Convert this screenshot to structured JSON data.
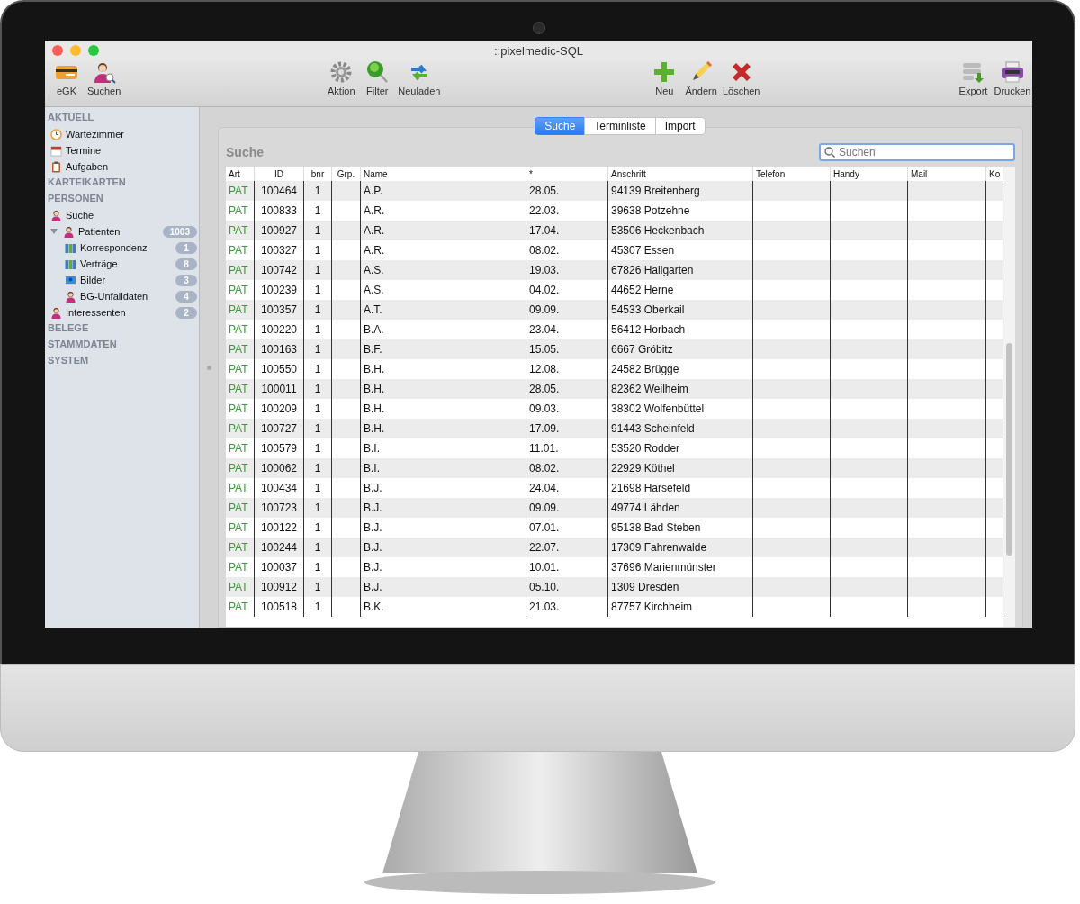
{
  "window": {
    "title": "::pixelmedic-SQL"
  },
  "toolbar": {
    "groups": [
      [
        {
          "label": "eGK",
          "kind": "card"
        },
        {
          "label": "Suchen",
          "kind": "person-search"
        }
      ],
      [
        {
          "label": "Aktion",
          "kind": "gear"
        },
        {
          "label": "Filter",
          "kind": "filter"
        },
        {
          "label": "Neuladen",
          "kind": "reload"
        }
      ],
      [
        {
          "label": "Neu",
          "kind": "plus"
        },
        {
          "label": "Ändern",
          "kind": "pencil"
        },
        {
          "label": "Löschen",
          "kind": "cross"
        }
      ],
      [
        {
          "label": "Export",
          "kind": "export"
        },
        {
          "label": "Drucken",
          "kind": "printer"
        }
      ]
    ]
  },
  "sidebar": {
    "sections": [
      {
        "title": "AKTUELL",
        "items": [
          {
            "label": "Wartezimmer",
            "kind": "clock"
          },
          {
            "label": "Termine",
            "kind": "calendar"
          },
          {
            "label": "Aufgaben",
            "kind": "clipboard"
          }
        ]
      },
      {
        "title": "KARTEIKARTEN"
      },
      {
        "title": "PERSONEN",
        "items": [
          {
            "label": "Suche",
            "kind": "person"
          },
          {
            "label": "Patienten",
            "kind": "person",
            "badge": "1003",
            "expanded": true,
            "children": [
              {
                "label": "Korrespondenz",
                "kind": "folders",
                "badge": "1"
              },
              {
                "label": "Verträge",
                "kind": "folders",
                "badge": "8"
              },
              {
                "label": "Bilder",
                "kind": "picture",
                "badge": "3"
              },
              {
                "label": "BG-Unfalldaten",
                "kind": "person",
                "badge": "4"
              }
            ]
          },
          {
            "label": "Interessenten",
            "kind": "person",
            "badge": "2"
          }
        ]
      },
      {
        "title": "BELEGE"
      },
      {
        "title": "STAMMDATEN"
      },
      {
        "title": "SYSTEM"
      }
    ]
  },
  "tabs": [
    {
      "label": "Suche",
      "selected": true
    },
    {
      "label": "Terminliste",
      "selected": false
    },
    {
      "label": "Import",
      "selected": false
    }
  ],
  "panel": {
    "title": "Suche"
  },
  "search": {
    "placeholder": "Suchen"
  },
  "table": {
    "columns": [
      "Art",
      "ID",
      "bnr",
      "Grp.",
      "Name",
      "*",
      "Anschrift",
      "Telefon",
      "Handy",
      "Mail",
      "Ko"
    ],
    "rows": [
      [
        "PAT",
        "100464",
        "1",
        "",
        "A.P.",
        "28.05.",
        "94139 Breitenberg",
        "",
        "",
        "",
        ""
      ],
      [
        "PAT",
        "100833",
        "1",
        "",
        "A.R.",
        "22.03.",
        "39638 Potzehne",
        "",
        "",
        "",
        ""
      ],
      [
        "PAT",
        "100927",
        "1",
        "",
        "A.R.",
        "17.04.",
        "53506 Heckenbach",
        "",
        "",
        "",
        ""
      ],
      [
        "PAT",
        "100327",
        "1",
        "",
        "A.R.",
        "08.02.",
        "45307 Essen",
        "",
        "",
        "",
        ""
      ],
      [
        "PAT",
        "100742",
        "1",
        "",
        "A.S.",
        "19.03.",
        "67826 Hallgarten",
        "",
        "",
        "",
        ""
      ],
      [
        "PAT",
        "100239",
        "1",
        "",
        "A.S.",
        "04.02.",
        "44652 Herne",
        "",
        "",
        "",
        ""
      ],
      [
        "PAT",
        "100357",
        "1",
        "",
        "A.T.",
        "09.09.",
        "54533 Oberkail",
        "",
        "",
        "",
        ""
      ],
      [
        "PAT",
        "100220",
        "1",
        "",
        "B.A.",
        "23.04.",
        "56412 Horbach",
        "",
        "",
        "",
        ""
      ],
      [
        "PAT",
        "100163",
        "1",
        "",
        "B.F.",
        "15.05.",
        "6667 Gröbitz",
        "",
        "",
        "",
        ""
      ],
      [
        "PAT",
        "100550",
        "1",
        "",
        "B.H.",
        "12.08.",
        "24582 Brügge",
        "",
        "",
        "",
        ""
      ],
      [
        "PAT",
        "100011",
        "1",
        "",
        "B.H.",
        "28.05.",
        "82362 Weilheim",
        "",
        "",
        "",
        ""
      ],
      [
        "PAT",
        "100209",
        "1",
        "",
        "B.H.",
        "09.03.",
        "38302 Wolfenbüttel",
        "",
        "",
        "",
        ""
      ],
      [
        "PAT",
        "100727",
        "1",
        "",
        "B.H.",
        "17.09.",
        "91443 Scheinfeld",
        "",
        "",
        "",
        ""
      ],
      [
        "PAT",
        "100579",
        "1",
        "",
        "B.I.",
        "11.01.",
        "53520 Rodder",
        "",
        "",
        "",
        ""
      ],
      [
        "PAT",
        "100062",
        "1",
        "",
        "B.I.",
        "08.02.",
        "22929 Köthel",
        "",
        "",
        "",
        ""
      ],
      [
        "PAT",
        "100434",
        "1",
        "",
        "B.J.",
        "24.04.",
        "21698 Harsefeld",
        "",
        "",
        "",
        ""
      ],
      [
        "PAT",
        "100723",
        "1",
        "",
        "B.J.",
        "09.09.",
        "49774 Lähden",
        "",
        "",
        "",
        ""
      ],
      [
        "PAT",
        "100122",
        "1",
        "",
        "B.J.",
        "07.01.",
        "95138 Bad Steben",
        "",
        "",
        "",
        ""
      ],
      [
        "PAT",
        "100244",
        "1",
        "",
        "B.J.",
        "22.07.",
        "17309 Fahrenwalde",
        "",
        "",
        "",
        ""
      ],
      [
        "PAT",
        "100037",
        "1",
        "",
        "B.J.",
        "10.01.",
        "37696 Marienmünster",
        "",
        "",
        "",
        ""
      ],
      [
        "PAT",
        "100912",
        "1",
        "",
        "B.J.",
        "05.10.",
        "1309 Dresden",
        "",
        "",
        "",
        ""
      ],
      [
        "PAT",
        "100518",
        "1",
        "",
        "B.K.",
        "21.03.",
        "87757 Kirchheim",
        "",
        "",
        "",
        ""
      ]
    ]
  }
}
